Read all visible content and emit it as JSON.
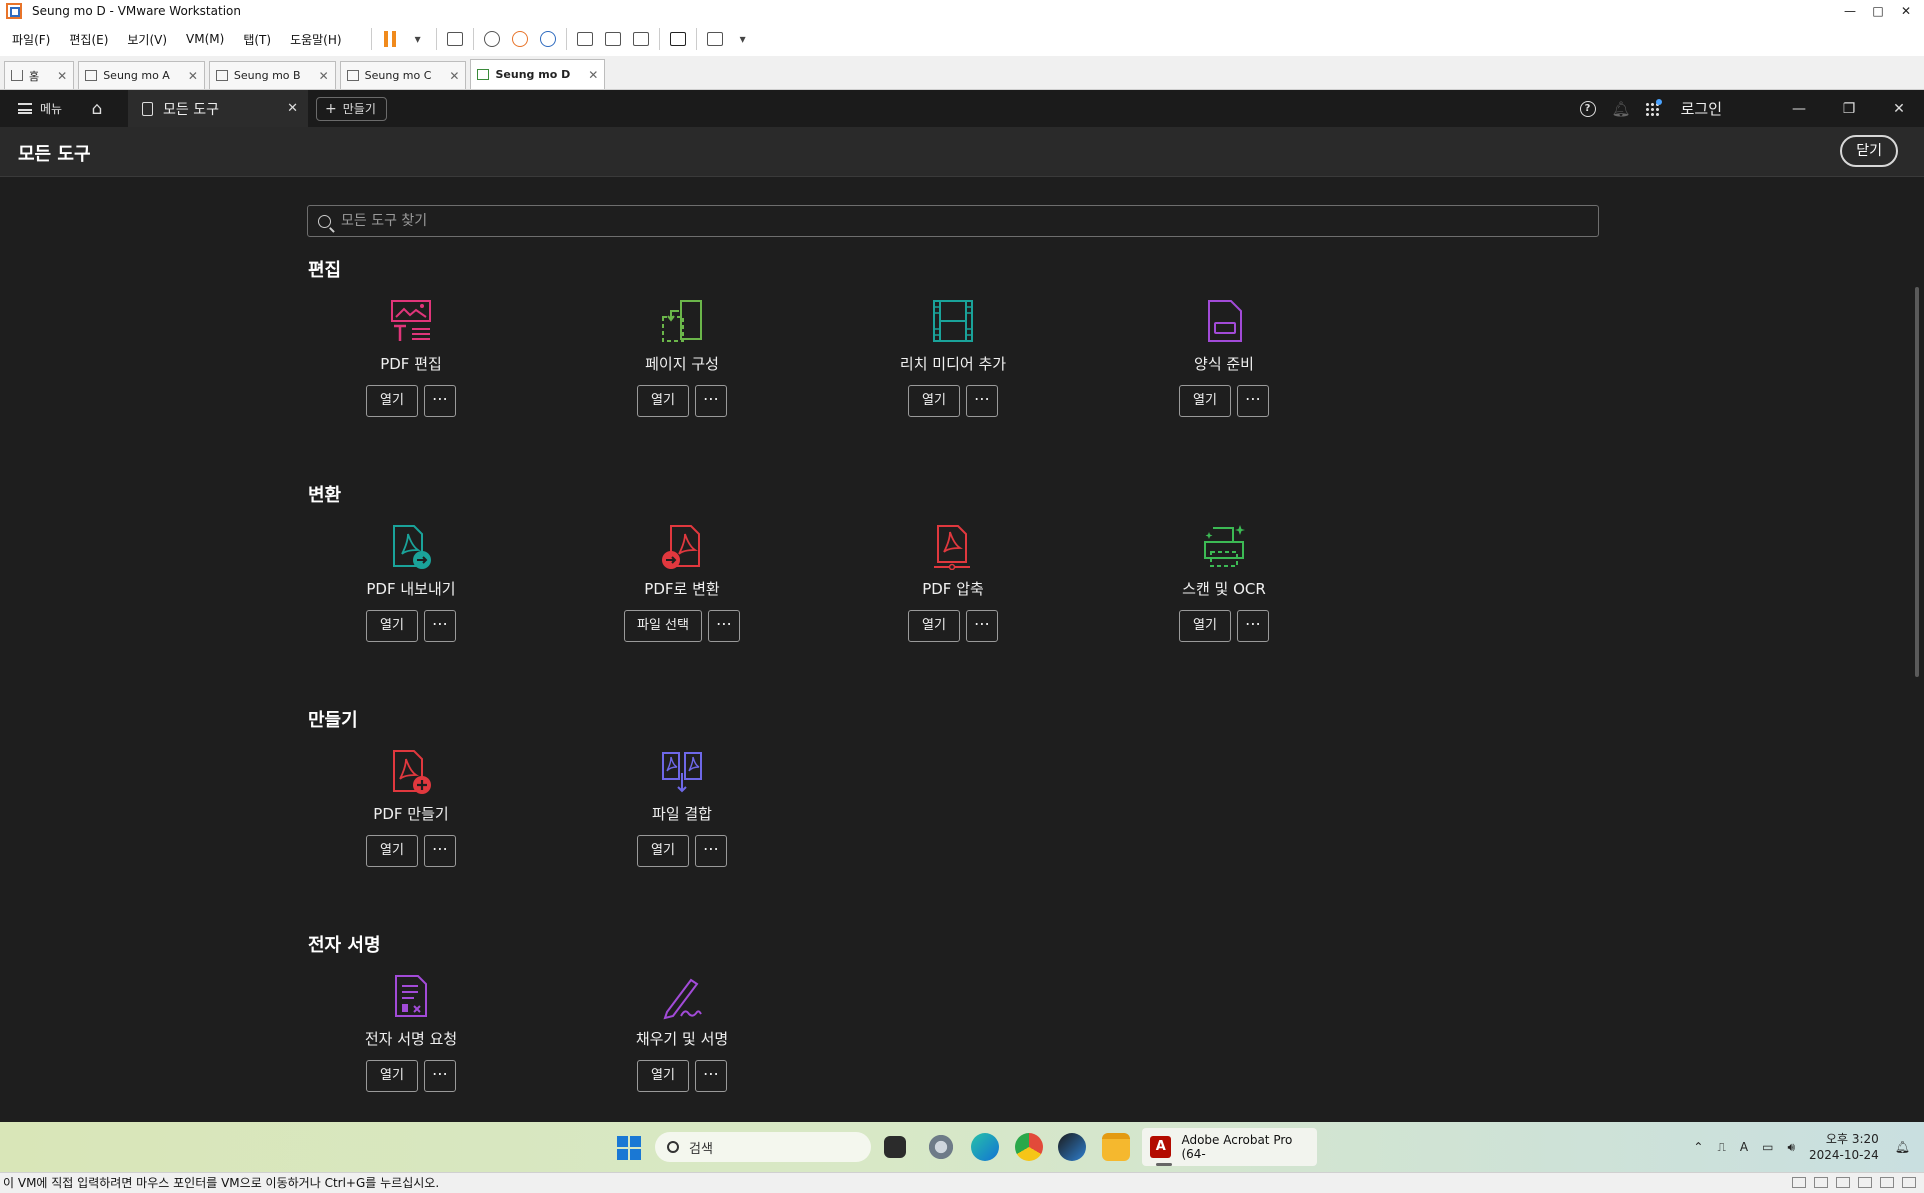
{
  "vm": {
    "title": "Seung mo D - VMware Workstation",
    "menus": [
      "파일(F)",
      "편집(E)",
      "보기(V)",
      "VM(M)",
      "탭(T)",
      "도움말(H)"
    ],
    "tabs": [
      {
        "label": "홈"
      },
      {
        "label": "Seung mo A"
      },
      {
        "label": "Seung mo B"
      },
      {
        "label": "Seung mo C"
      },
      {
        "label": "Seung mo D"
      }
    ],
    "status": "이 VM에 직접 입력하려면 마우스 포인터를 VM으로 이동하거나 Ctrl+G를 누르십시오."
  },
  "acrobat": {
    "menu_label": "메뉴",
    "tab_label": "모든 도구",
    "create_label": "만들기",
    "login_label": "로그인",
    "page_title": "모든 도구",
    "close_label": "닫기",
    "search_placeholder": "모든 도구 찾기",
    "sections": [
      {
        "title": "편집",
        "tools": [
          {
            "name": "PDF 편집",
            "button": "열기"
          },
          {
            "name": "페이지 구성",
            "button": "열기"
          },
          {
            "name": "리치 미디어 추가",
            "button": "열기"
          },
          {
            "name": "양식 준비",
            "button": "열기"
          }
        ]
      },
      {
        "title": "변환",
        "tools": [
          {
            "name": "PDF 내보내기",
            "button": "열기"
          },
          {
            "name": "PDF로 변환",
            "button": "파일 선택"
          },
          {
            "name": "PDF 압축",
            "button": "열기"
          },
          {
            "name": "스캔 및 OCR",
            "button": "열기"
          }
        ]
      },
      {
        "title": "만들기",
        "tools": [
          {
            "name": "PDF 만들기",
            "button": "열기"
          },
          {
            "name": "파일 결합",
            "button": "열기"
          }
        ]
      },
      {
        "title": "전자 서명",
        "tools": [
          {
            "name": "전자 서명 요청",
            "button": "열기"
          },
          {
            "name": "채우기 및 서명",
            "button": "열기"
          }
        ]
      }
    ],
    "more_label": "⋯"
  },
  "taskbar": {
    "search_label": "검색",
    "acrobat_label": "Adobe Acrobat Pro (64-",
    "time": "오후 3:20",
    "date": "2024-10-24"
  },
  "colors": {
    "edit_pink": "#e0357a",
    "green": "#6bb64a",
    "teal": "#1aa39a",
    "purple": "#a24bd8",
    "red": "#e0383e",
    "scan_green": "#3cba54",
    "indigo": "#6e68e8"
  }
}
